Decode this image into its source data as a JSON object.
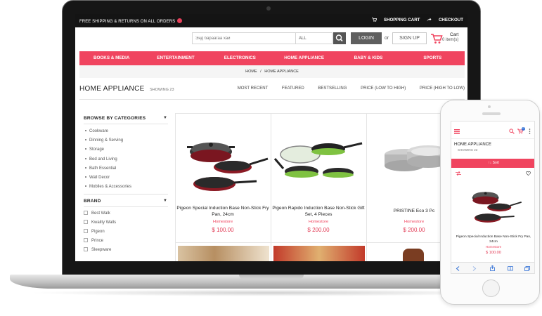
{
  "topbar": {
    "shipping_text": "FREE SHIPPING & RETURNS ON ALL ORDERS",
    "shopping_cart": "SHOPPING CART",
    "checkout": "CHECKOUT"
  },
  "header": {
    "search_placeholder": "Энд бараагаа хай",
    "category_select": "ALL",
    "login_label": "LOGIN",
    "or_text": "or",
    "signup_label": "SIGN UP",
    "cart_label": "Cart",
    "cart_items": "0 item(s)"
  },
  "nav": {
    "items": [
      "BOOKS & MEDIA",
      "ENTERTAINMENT",
      "ELECTRONICS",
      "HOME APPLIANCE",
      "BABY & KIDS",
      "SPORTS"
    ]
  },
  "breadcrumb": {
    "home": "HOME",
    "separator": "/",
    "current": "HOME APPLIANCE"
  },
  "page": {
    "title": "HOME APPLIANCE",
    "showing": "SHOWING 23"
  },
  "sort": {
    "options": [
      "MOST RECENT",
      "FEATURED",
      "BESTSELLING",
      "PRICE (LOW TO HIGH)",
      "PRICE (HIGH TO LOW)"
    ]
  },
  "sidebar": {
    "categories_title": "BROWSE BY CATEGORIES",
    "categories": [
      "Cookware",
      "Dinning & Serving",
      "Storage",
      "Bed and Living",
      "Bath Essential",
      "Wall Decor",
      "Mobiles & Accessories"
    ],
    "brand_title": "BRAND",
    "brands": [
      "Best Walk",
      "Kwality Walls",
      "Pigeon",
      "Prince",
      "Sleepware"
    ]
  },
  "products": [
    {
      "name": "Pigeon Special Induction Base Non-Stick Fry Pan, 24cm",
      "store": "Homestore",
      "price": "$ 100.00"
    },
    {
      "name": "Pigeon Rapido Induction Base Non-Stick Gift Set, 4 Pieces",
      "store": "Homestore",
      "price": "$ 200.00"
    },
    {
      "name": "PRISTINE Eco 3 Pc",
      "store": "Homestore",
      "price": "$ 200.00"
    }
  ],
  "mobile": {
    "title": "HOME APPLIANCE",
    "showing": "SHOWING 23",
    "sort_label": "↑↓ Sort",
    "cart_badge": "0",
    "product": {
      "name": "Pigeon Special Induction Base Non-Stick Fry Pan, 24cm",
      "store": "Homestore",
      "price": "$ 100.00"
    }
  },
  "colors": {
    "accent": "#f0445f",
    "topbar": "#141414",
    "price": "#e23b55"
  }
}
